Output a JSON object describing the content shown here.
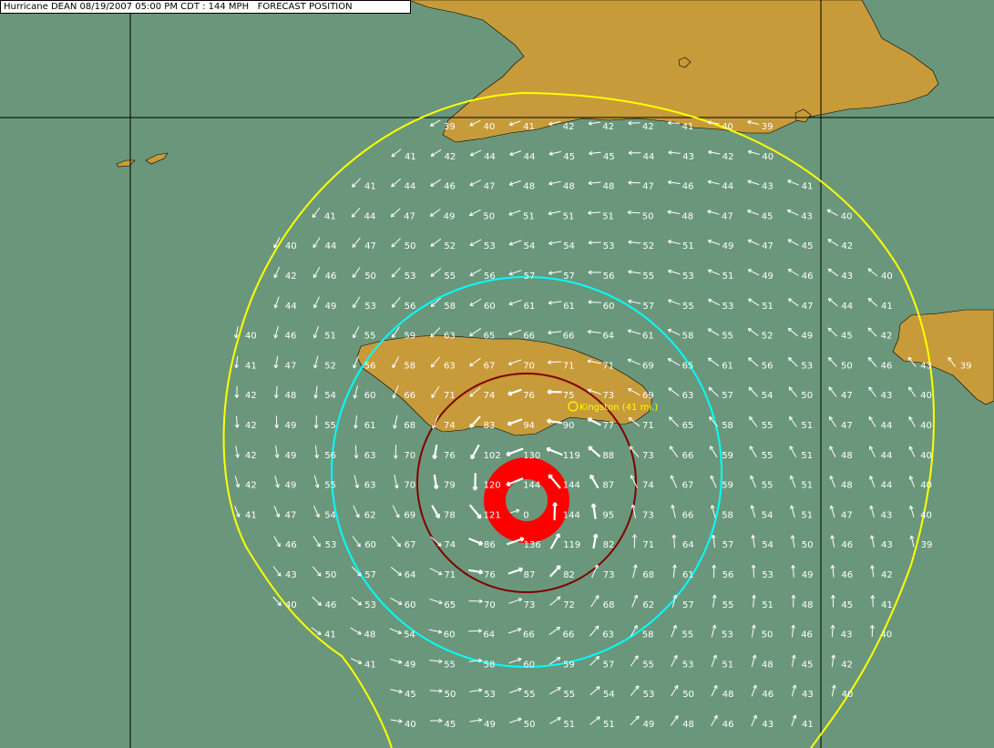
{
  "title": "Hurricane DEAN 08/19/2007 05:00 PM CDT : 144 MPH   FORECAST POSITION",
  "city": {
    "name": "Kingston",
    "distance": "(41 mi.)"
  },
  "colors": {
    "ocean": "#6a977b",
    "land": "#c79a3a",
    "grid": "#000000",
    "outer_ring": "#ffff00",
    "mid_ring": "#00ffff",
    "inner_ring": "#800000",
    "eyewall": "#ff0000",
    "text": "#ffffff",
    "city_label": "#ffff00"
  },
  "eye": {
    "max_wind_mph": "144",
    "center_value": "0"
  },
  "wind_rows": [
    [
      "39",
      "40",
      "41",
      "42",
      "42",
      "42",
      "41",
      "40",
      "39"
    ],
    [
      "41",
      "42",
      "44",
      "44",
      "45",
      "45",
      "44",
      "43",
      "42",
      "40"
    ],
    [
      "41",
      "44",
      "46",
      "47",
      "48",
      "48",
      "48",
      "47",
      "46",
      "44",
      "43",
      "41"
    ],
    [
      "41",
      "44",
      "47",
      "49",
      "50",
      "51",
      "51",
      "51",
      "50",
      "48",
      "47",
      "45",
      "43",
      "40"
    ],
    [
      "40",
      "44",
      "47",
      "50",
      "52",
      "53",
      "54",
      "54",
      "53",
      "52",
      "51",
      "49",
      "47",
      "45",
      "42"
    ],
    [
      "42",
      "46",
      "50",
      "53",
      "55",
      "56",
      "57",
      "57",
      "56",
      "55",
      "53",
      "51",
      "49",
      "46",
      "43",
      "40"
    ],
    [
      "44",
      "49",
      "53",
      "56",
      "58",
      "60",
      "61",
      "61",
      "60",
      "57",
      "55",
      "53",
      "51",
      "47",
      "44",
      "41"
    ],
    [
      "40",
      "46",
      "51",
      "55",
      "59",
      "63",
      "65",
      "66",
      "66",
      "64",
      "61",
      "58",
      "55",
      "52",
      "49",
      "45",
      "42"
    ],
    [
      "41",
      "47",
      "52",
      "56",
      "58",
      "63",
      "67",
      "70",
      "71",
      "71",
      "69",
      "65",
      "61",
      "56",
      "53",
      "50",
      "46",
      "43",
      "39"
    ],
    [
      "42",
      "48",
      "54",
      "60",
      "66",
      "71",
      "74",
      "76",
      "75",
      "73",
      "69",
      "63",
      "57",
      "54",
      "50",
      "47",
      "43",
      "40"
    ],
    [
      "42",
      "49",
      "55",
      "61",
      "68",
      "74",
      "83",
      "94",
      "90",
      "77",
      "71",
      "65",
      "58",
      "55",
      "51",
      "47",
      "44",
      "40"
    ],
    [
      "42",
      "49",
      "56",
      "63",
      "70",
      "76",
      "102",
      "130",
      "119",
      "88",
      "73",
      "66",
      "59",
      "55",
      "51",
      "48",
      "44",
      "40"
    ],
    [
      "42",
      "49",
      "55",
      "63",
      "70",
      "79",
      "120",
      "144",
      "144",
      "87",
      "74",
      "67",
      "59",
      "55",
      "51",
      "48",
      "44",
      "40"
    ],
    [
      "41",
      "47",
      "54",
      "62",
      "69",
      "78",
      "121",
      "0",
      "144",
      "95",
      "73",
      "66",
      "58",
      "54",
      "51",
      "47",
      "43",
      "40"
    ],
    [
      "46",
      "53",
      "60",
      "67",
      "74",
      "86",
      "136",
      "119",
      "82",
      "71",
      "64",
      "57",
      "54",
      "50",
      "46",
      "43",
      "39"
    ],
    [
      "43",
      "50",
      "57",
      "64",
      "71",
      "76",
      "87",
      "82",
      "73",
      "68",
      "61",
      "56",
      "53",
      "49",
      "46",
      "42"
    ],
    [
      "40",
      "46",
      "53",
      "60",
      "65",
      "70",
      "73",
      "72",
      "68",
      "62",
      "57",
      "55",
      "51",
      "48",
      "45",
      "41"
    ],
    [
      "41",
      "48",
      "54",
      "60",
      "64",
      "66",
      "66",
      "63",
      "58",
      "55",
      "53",
      "50",
      "46",
      "43",
      "40"
    ],
    [
      "41",
      "49",
      "55",
      "58",
      "60",
      "59",
      "57",
      "55",
      "53",
      "51",
      "48",
      "45",
      "42"
    ],
    [
      "45",
      "50",
      "53",
      "55",
      "55",
      "54",
      "53",
      "50",
      "48",
      "46",
      "43",
      "40"
    ],
    [
      "40",
      "45",
      "49",
      "50",
      "51",
      "51",
      "49",
      "48",
      "46",
      "43",
      "41"
    ]
  ]
}
